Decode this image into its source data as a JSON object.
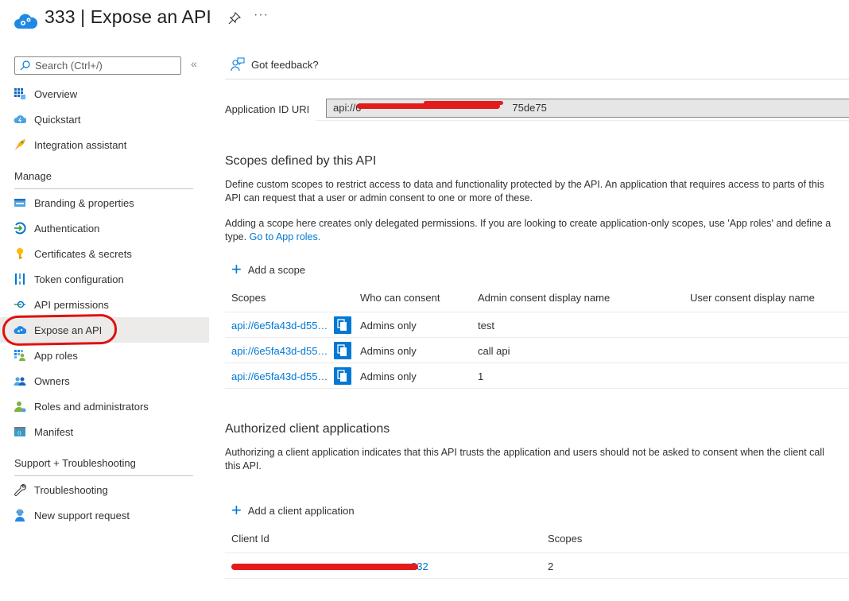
{
  "header": {
    "title": "333 | Expose an API",
    "app_icon": "app-registration-cloud-icon",
    "pin_icon": "pin-icon",
    "more_label": "···"
  },
  "sidebar": {
    "search_placeholder": "Search (Ctrl+/)",
    "collapse_label": "«",
    "top_items": [
      {
        "label": "Overview",
        "icon": "overview-grid-icon"
      },
      {
        "label": "Quickstart",
        "icon": "quickstart-cloud-icon"
      },
      {
        "label": "Integration assistant",
        "icon": "rocket-icon"
      }
    ],
    "manage_heading": "Manage",
    "manage_items": [
      {
        "label": "Branding & properties",
        "icon": "branding-icon"
      },
      {
        "label": "Authentication",
        "icon": "authentication-icon"
      },
      {
        "label": "Certificates & secrets",
        "icon": "key-icon"
      },
      {
        "label": "Token configuration",
        "icon": "token-config-icon"
      },
      {
        "label": "API permissions",
        "icon": "api-permissions-icon"
      },
      {
        "label": "Expose an API",
        "icon": "expose-api-cloud-icon",
        "active": true
      },
      {
        "label": "App roles",
        "icon": "app-roles-icon"
      },
      {
        "label": "Owners",
        "icon": "owners-icon"
      },
      {
        "label": "Roles and administrators",
        "icon": "roles-admin-icon"
      },
      {
        "label": "Manifest",
        "icon": "manifest-icon"
      }
    ],
    "support_heading": "Support + Troubleshooting",
    "support_items": [
      {
        "label": "Troubleshooting",
        "icon": "wrench-icon"
      },
      {
        "label": "New support request",
        "icon": "support-person-icon"
      }
    ]
  },
  "main": {
    "feedback_label": "Got feedback?",
    "app_id_uri_label": "Application ID URI",
    "app_id_uri_value_prefix": "api://6",
    "app_id_uri_value_suffix": "75de75",
    "scopes": {
      "title": "Scopes defined by this API",
      "desc_line1": "Define custom scopes to restrict access to data and functionality protected by the API. An application that requires access to parts of this",
      "desc_line2": "API can request that a user or admin consent to one or more of these.",
      "desc2_line1": "Adding a scope here creates only delegated permissions. If you are looking to create application-only scopes, use 'App roles' and define a",
      "desc2_line2_prefix": "type.",
      "go_to_app_roles": "Go to App roles.",
      "add_label": "Add a scope",
      "columns": [
        "Scopes",
        "Who can consent",
        "Admin consent display name",
        "User consent display name"
      ],
      "rows": [
        {
          "scope": "api://6e5fa43d-d55…",
          "who": "Admins only",
          "admin_name": "test",
          "user_name": ""
        },
        {
          "scope": "api://6e5fa43d-d55…",
          "who": "Admins only",
          "admin_name": "call api",
          "user_name": ""
        },
        {
          "scope": "api://6e5fa43d-d55…",
          "who": "Admins only",
          "admin_name": "1",
          "user_name": ""
        }
      ]
    },
    "clients": {
      "title": "Authorized client applications",
      "desc_line1": "Authorizing a client application indicates that this API trusts the application and users should not be asked to consent when the client call",
      "desc_line2": "this API.",
      "add_label": "Add a client application",
      "columns": [
        "Client Id",
        "Scopes"
      ],
      "rows": [
        {
          "client_id_suffix": "332",
          "scopes": "2"
        }
      ]
    }
  },
  "colors": {
    "accent": "#0078d4",
    "active_bg": "#edebe9",
    "annotation_red": "#e01010"
  }
}
